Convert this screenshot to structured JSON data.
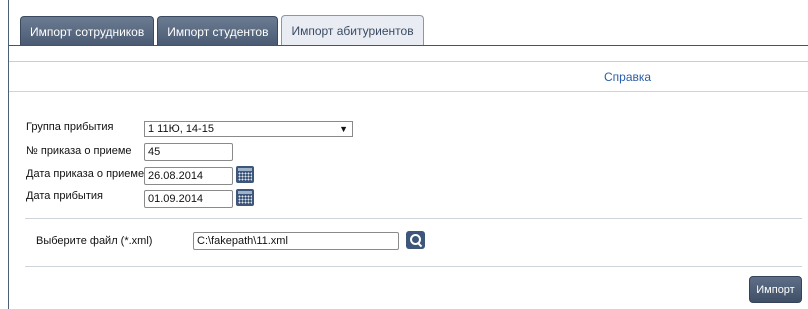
{
  "tabs": [
    {
      "label": "Импорт сотрудников",
      "active": false
    },
    {
      "label": "Импорт студентов",
      "active": false
    },
    {
      "label": "Импорт абитуриентов",
      "active": true
    }
  ],
  "toolbar": {
    "help_label": "Справка"
  },
  "form": {
    "arrival_group": {
      "label": "Группа прибытия",
      "value": "1 11Ю, 14-15"
    },
    "order_number": {
      "label": "№ приказа о приеме",
      "value": "45"
    },
    "order_date": {
      "label": "Дата приказа о приеме",
      "value": "26.08.2014"
    },
    "arrival_date": {
      "label": "Дата прибытия",
      "value": "01.09.2014"
    },
    "file": {
      "label": "Выберите файл (*.xml)",
      "value": "C:\\fakepath\\11.xml"
    }
  },
  "actions": {
    "import_label": "Импорт"
  },
  "colors": {
    "tab_dark": "#4a5a72",
    "accent_link": "#2b5ea8",
    "icon_bg": "#3e5679"
  }
}
